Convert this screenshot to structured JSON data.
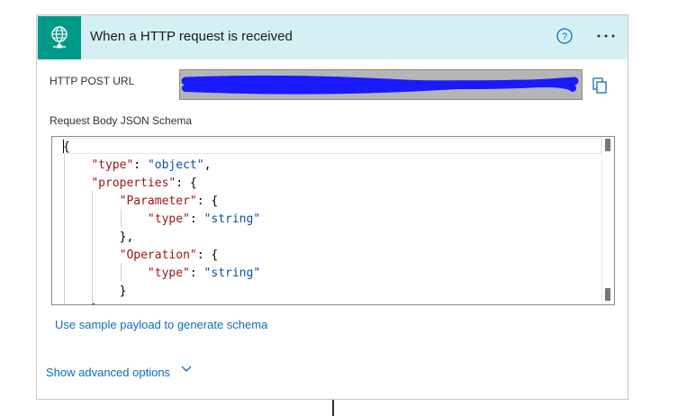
{
  "card": {
    "title": "When a HTTP request is received",
    "accent_color": "#00998a",
    "header_bg": "#d5f0f3",
    "icons": {
      "trigger": "globe-network-icon",
      "help": "help-circle-icon",
      "more": "more-ellipsis-icon",
      "copy": "copy-icon",
      "expand": "chevron-down-icon"
    }
  },
  "url": {
    "label": "HTTP POST URL",
    "redaction_color": "#1a1aff"
  },
  "schema": {
    "label": "Request Body JSON Schema",
    "lines": [
      [
        {
          "t": "p",
          "v": "{"
        }
      ],
      [
        {
          "t": "p",
          "v": "    "
        },
        {
          "t": "k",
          "v": "\"type\""
        },
        {
          "t": "p",
          "v": ": "
        },
        {
          "t": "s",
          "v": "\"object\""
        },
        {
          "t": "p",
          "v": ","
        }
      ],
      [
        {
          "t": "p",
          "v": "    "
        },
        {
          "t": "k",
          "v": "\"properties\""
        },
        {
          "t": "p",
          "v": ": {"
        }
      ],
      [
        {
          "t": "p",
          "v": "        "
        },
        {
          "t": "k",
          "v": "\"Parameter\""
        },
        {
          "t": "p",
          "v": ": {"
        }
      ],
      [
        {
          "t": "p",
          "v": "            "
        },
        {
          "t": "k",
          "v": "\"type\""
        },
        {
          "t": "p",
          "v": ": "
        },
        {
          "t": "s",
          "v": "\"string\""
        }
      ],
      [
        {
          "t": "p",
          "v": "        },"
        }
      ],
      [
        {
          "t": "p",
          "v": "        "
        },
        {
          "t": "k",
          "v": "\"Operation\""
        },
        {
          "t": "p",
          "v": ": {"
        }
      ],
      [
        {
          "t": "p",
          "v": "            "
        },
        {
          "t": "k",
          "v": "\"type\""
        },
        {
          "t": "p",
          "v": ": "
        },
        {
          "t": "s",
          "v": "\"string\""
        }
      ],
      [
        {
          "t": "p",
          "v": "        }"
        }
      ],
      [
        {
          "t": "p",
          "v": "    }"
        }
      ]
    ]
  },
  "links": {
    "generate_schema": "Use sample payload to generate schema",
    "advanced_options": "Show advanced options"
  }
}
